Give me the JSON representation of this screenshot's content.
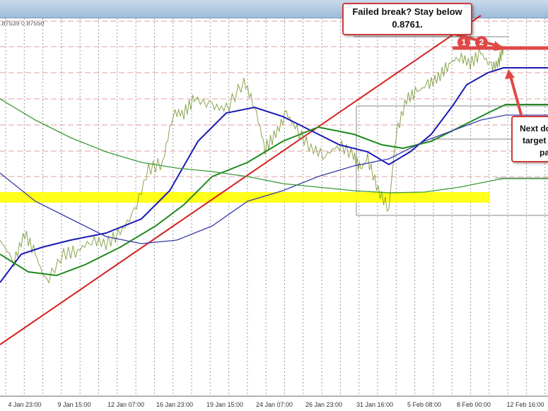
{
  "header": {
    "quote_text": ".87539 0.87550"
  },
  "chart_data": {
    "type": "line",
    "title": "",
    "xlabel": "",
    "ylabel": "",
    "x_unit": "bar index",
    "ylim": [
      0.85175,
      0.87825
    ],
    "grid": true,
    "x_tick_labels": [
      "4 Jan 23:00",
      "9 Jan 15:00",
      "12 Jan 07:00",
      "16 Jan 23:00",
      "19 Jan 15:00",
      "24 Jan 07:00",
      "26 Jan 23:00",
      "31 Jan 16:00",
      "5 Feb 08:00",
      "8 Feb 00:00",
      "12 Feb 16:00"
    ],
    "x_tick_positions": [
      7,
      21,
      35.6,
      49.4,
      63.6,
      77.6,
      91.6,
      106,
      120,
      134,
      148.6
    ],
    "series": [
      {
        "name": "price",
        "color": "#6b8e23",
        "x": [
          0,
          4,
          7,
          10,
          13,
          18,
          22,
          26,
          30,
          34,
          38,
          42,
          46,
          49,
          52,
          55,
          60,
          64,
          69,
          72,
          75,
          78,
          81,
          84,
          88,
          92,
          96,
          100,
          102,
          104,
          107,
          110,
          112,
          115,
          118,
          121,
          124,
          127,
          130,
          133,
          136,
          139,
          141,
          142.4
        ],
        "y": [
          0.8625,
          0.861,
          0.863,
          0.8615,
          0.8595,
          0.8615,
          0.86175,
          0.8625,
          0.86225,
          0.863,
          0.8645,
          0.8675,
          0.868,
          0.8715,
          0.8715,
          0.8725,
          0.872,
          0.87175,
          0.87375,
          0.872,
          0.869,
          0.87,
          0.8715,
          0.87025,
          0.869,
          0.8685,
          0.86925,
          0.8685,
          0.8675,
          0.86825,
          0.866,
          0.86475,
          0.87,
          0.8725,
          0.873,
          0.8735,
          0.874,
          0.875,
          0.8755,
          0.875,
          0.87575,
          0.87475,
          0.875,
          0.87625
        ]
      },
      {
        "name": "100-bar MA",
        "color": "#1a1ab8",
        "x": [
          0,
          6,
          12,
          20,
          30,
          40,
          48,
          56,
          64,
          72,
          80,
          88,
          96,
          104,
          110,
          116,
          122,
          128,
          132,
          138,
          142.4,
          155
        ],
        "y": [
          0.8595,
          0.8615,
          0.862,
          0.8625,
          0.863,
          0.864,
          0.866,
          0.8695,
          0.8715,
          0.8719,
          0.87125,
          0.87025,
          0.86925,
          0.86875,
          0.86785,
          0.86875,
          0.87,
          0.872,
          0.8735,
          0.87435,
          0.8747,
          0.8747
        ]
      },
      {
        "name": "200-bar MA",
        "color": "#1f8a1f",
        "x": [
          0,
          8,
          16,
          24,
          34,
          44,
          52,
          60,
          70,
          80,
          90,
          100,
          108,
          114,
          122,
          130,
          138,
          143,
          155
        ],
        "y": [
          0.8615,
          0.86025,
          0.86,
          0.86075,
          0.862,
          0.8635,
          0.865,
          0.867,
          0.868,
          0.8695,
          0.8705,
          0.87,
          0.86925,
          0.869,
          0.8695,
          0.8705,
          0.8715,
          0.8721,
          0.8721
        ]
      },
      {
        "name": "100-bar MA (4-hour)",
        "color": "#3a3aa8",
        "x": [
          0,
          10,
          20,
          30,
          40,
          50,
          60,
          70,
          80,
          90,
          100,
          110,
          120,
          128,
          136,
          143,
          155
        ],
        "y": [
          0.86725,
          0.86525,
          0.864,
          0.86275,
          0.86225,
          0.8625,
          0.8635,
          0.86525,
          0.866,
          0.867,
          0.86775,
          0.86825,
          0.8695,
          0.87025,
          0.871,
          0.87135,
          0.87135
        ]
      },
      {
        "name": "200-bar MA (4-hour)",
        "color": "#3a9a3a",
        "x": [
          0,
          10,
          20,
          30,
          40,
          50,
          60,
          70,
          80,
          90,
          100,
          110,
          120,
          130,
          140,
          142.4,
          155
        ],
        "y": [
          0.8725,
          0.871,
          0.86975,
          0.86875,
          0.868,
          0.8676,
          0.86735,
          0.867,
          0.8665,
          0.86625,
          0.866,
          0.86585,
          0.8659,
          0.86625,
          0.86675,
          0.86685,
          0.86685
        ]
      }
    ],
    "trendline": {
      "x": [
        0,
        136
      ],
      "y": [
        0.8551,
        0.8784
      ],
      "color": "#d42020"
    },
    "support_zone": {
      "y_low": 0.86515,
      "y_high": 0.8659,
      "x": [
        0,
        138.4
      ],
      "color": "#ffff00"
    },
    "resistance": {
      "level": 0.8761,
      "x_start": 128,
      "color": "#e04848"
    },
    "annotations": [
      {
        "text_line1": "Failed break?  Stay below",
        "text_line2": "0.8761."
      },
      {
        "text_line1": "Next do",
        "text_line2": "target",
        "text_line3": "pa"
      }
    ],
    "markers": [
      "1",
      "2"
    ]
  }
}
